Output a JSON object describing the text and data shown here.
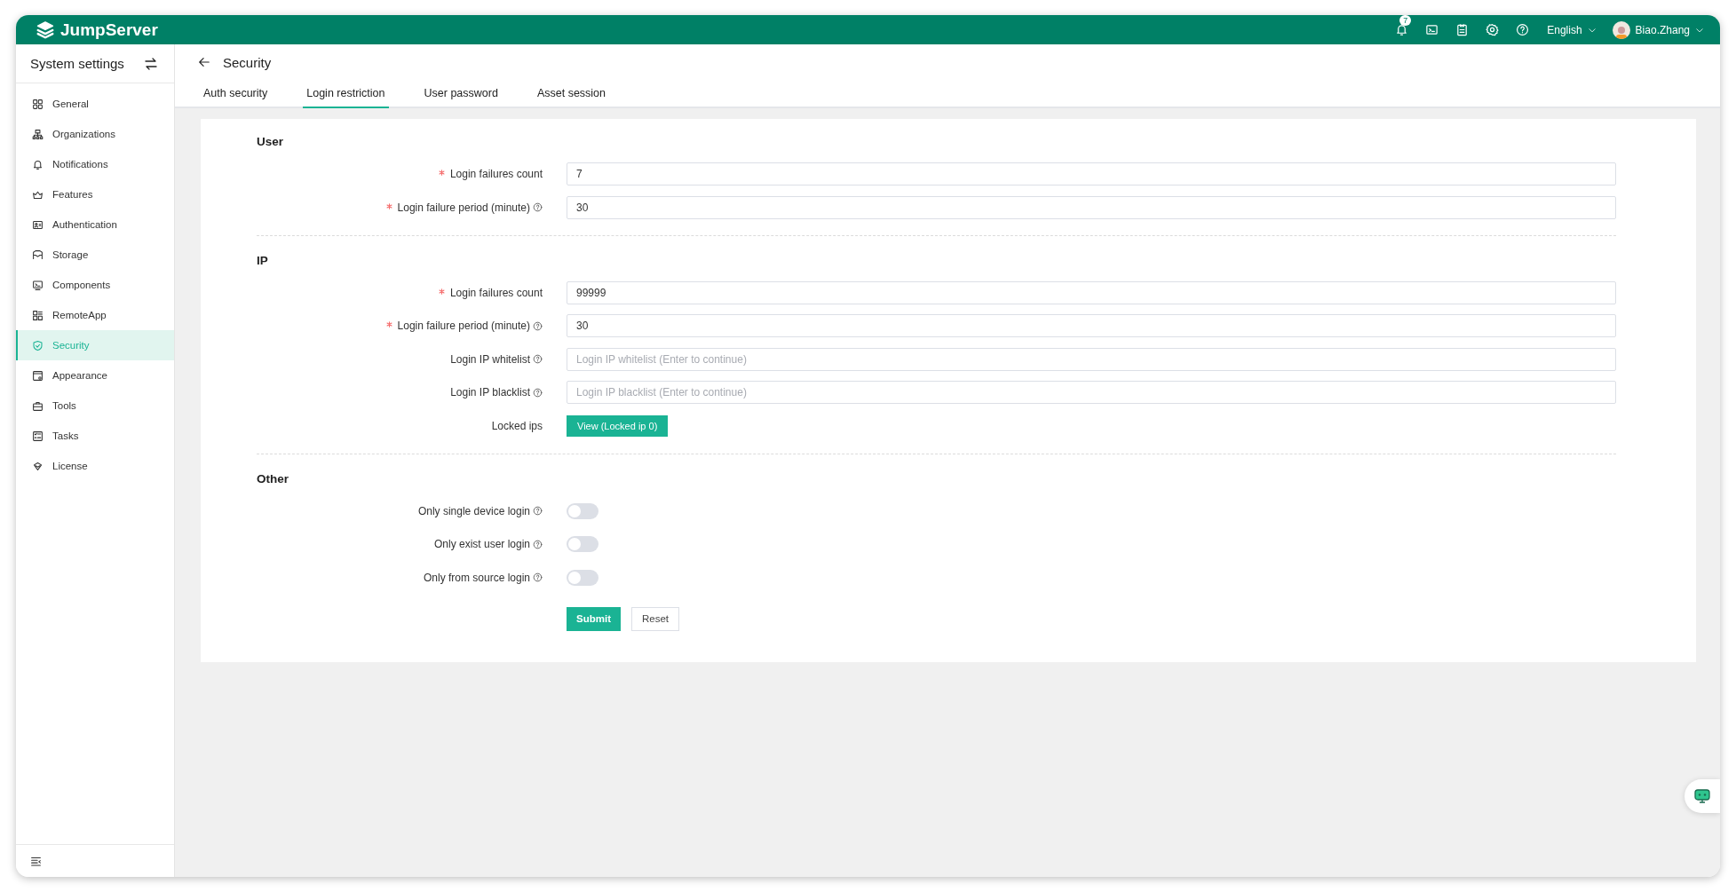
{
  "topbar": {
    "logo": "JumpServer",
    "notification_badge": "7",
    "language": "English",
    "user": "Biao.Zhang"
  },
  "sidebar": {
    "title": "System settings",
    "items": [
      {
        "label": "General",
        "selected": false
      },
      {
        "label": "Organizations",
        "selected": false
      },
      {
        "label": "Notifications",
        "selected": false
      },
      {
        "label": "Features",
        "selected": false
      },
      {
        "label": "Authentication",
        "selected": false
      },
      {
        "label": "Storage",
        "selected": false
      },
      {
        "label": "Components",
        "selected": false
      },
      {
        "label": "RemoteApp",
        "selected": false
      },
      {
        "label": "Security",
        "selected": true
      },
      {
        "label": "Appearance",
        "selected": false
      },
      {
        "label": "Tools",
        "selected": false
      },
      {
        "label": "Tasks",
        "selected": false
      },
      {
        "label": "License",
        "selected": false
      }
    ]
  },
  "page": {
    "title": "Security",
    "tabs": [
      {
        "label": "Auth security",
        "selected": false
      },
      {
        "label": "Login restriction",
        "selected": true
      },
      {
        "label": "User password",
        "selected": false
      },
      {
        "label": "Asset session",
        "selected": false
      }
    ]
  },
  "sections": [
    {
      "title": "User",
      "fields": [
        {
          "kind": "input",
          "label": "Login failures count",
          "required": true,
          "help": false,
          "value": "7"
        },
        {
          "kind": "input",
          "label": "Login failure period (minute)",
          "required": true,
          "help": true,
          "value": "30"
        }
      ]
    },
    {
      "title": "IP",
      "fields": [
        {
          "kind": "input",
          "label": "Login failures count",
          "required": true,
          "help": false,
          "value": "99999"
        },
        {
          "kind": "input",
          "label": "Login failure period (minute)",
          "required": true,
          "help": true,
          "value": "30"
        },
        {
          "kind": "input",
          "label": "Login IP whitelist",
          "required": false,
          "help": true,
          "placeholder": "Login IP whitelist (Enter to continue)"
        },
        {
          "kind": "input",
          "label": "Login IP blacklist",
          "required": false,
          "help": true,
          "placeholder": "Login IP blacklist (Enter to continue)"
        },
        {
          "kind": "button",
          "label": "Locked ips",
          "required": false,
          "help": false,
          "button": "View (Locked ip 0)"
        }
      ]
    },
    {
      "title": "Other",
      "fields": [
        {
          "kind": "switch",
          "label": "Only single device login",
          "required": false,
          "help": true,
          "on": false
        },
        {
          "kind": "switch",
          "label": "Only exist user login",
          "required": false,
          "help": true,
          "on": false
        },
        {
          "kind": "switch",
          "label": "Only from source login",
          "required": false,
          "help": true,
          "on": false
        }
      ]
    }
  ],
  "actions": {
    "submit": "Submit",
    "reset": "Reset"
  }
}
